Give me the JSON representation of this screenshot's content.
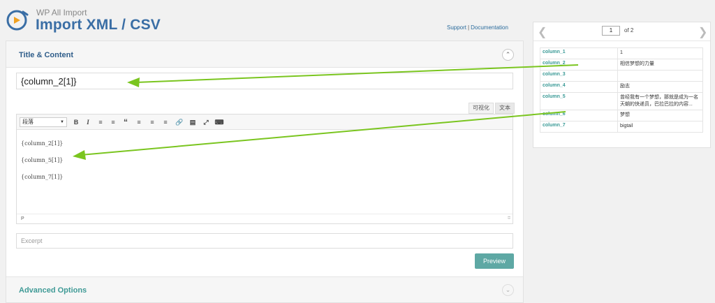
{
  "header": {
    "app_name": "WP All Import",
    "page_title": "Import XML / CSV",
    "support_link": "Support",
    "separator": "|",
    "docs_link": "Documentation"
  },
  "title_content": {
    "section_title": "Title & Content",
    "title_value": "{column_2[1]}",
    "tab_visual": "可视化",
    "tab_text": "文本",
    "format_select": "段落",
    "editor_lines": [
      "{column_2[1]}",
      "{column_5[1]}",
      "{column_7[1]}"
    ],
    "path_indicator": "P",
    "excerpt_placeholder": "Excerpt",
    "preview_label": "Preview"
  },
  "advanced": {
    "section_title": "Advanced Options"
  },
  "data_panel": {
    "page_current": "1",
    "page_of": "of 2",
    "rows": [
      {
        "key": "column_1",
        "value": "1"
      },
      {
        "key": "column_2",
        "value": "相信梦想的力量"
      },
      {
        "key": "column_3",
        "value": ""
      },
      {
        "key": "column_4",
        "value": "励志"
      },
      {
        "key": "column_5",
        "value": "曾经我有一个梦想，那就是成为一名天朝的快递员，巴拉巴拉的内容..."
      },
      {
        "key": "column_6",
        "value": "梦想"
      },
      {
        "key": "column_7",
        "value": "bigtail"
      }
    ]
  },
  "colors": {
    "accent_blue": "#3a6ea5",
    "teal": "#5ea8a4",
    "arrow_green": "#7ac51f"
  }
}
